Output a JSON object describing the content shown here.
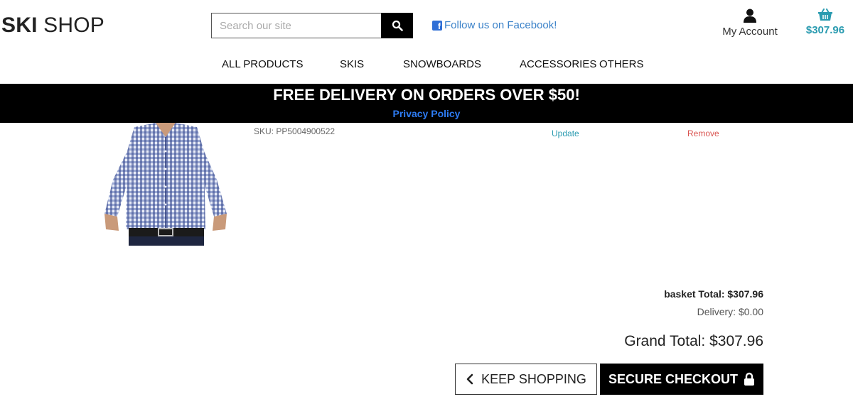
{
  "header": {
    "logo_bold": "SKI",
    "logo_thin": "SHOP",
    "search_placeholder": "Search our site",
    "facebook_label": "Follow us on Facebook!",
    "account_label": "My Account",
    "basket_total": "$307.96"
  },
  "nav": {
    "items": [
      "ALL PRODUCTS",
      "SKIS",
      "SNOWBOARDS",
      "ACCESSORIES",
      "OTHERS"
    ]
  },
  "banner": {
    "headline": "FREE DELIVERY ON ORDERS OVER $50!",
    "policy_link": "Privacy Policy"
  },
  "product": {
    "sku": "SKU: PP5004900522",
    "update_label": "Update",
    "remove_label": "Remove"
  },
  "summary": {
    "basket_total": "basket Total: $307.96",
    "delivery": "Delivery: $0.00",
    "grand_total": "Grand Total: $307.96"
  },
  "actions": {
    "keep_shopping": "KEEP SHOPPING",
    "secure_checkout": "SECURE CHECKOUT"
  },
  "colors": {
    "accent_teal": "#2a9bb0",
    "link_blue": "#2e7df5",
    "remove_red": "#d9534f",
    "banner_bg": "#000000"
  },
  "icons": {
    "search": "search-icon",
    "facebook": "facebook-icon",
    "account": "user-icon",
    "basket": "basket-icon",
    "back": "chevron-left-icon",
    "lock": "lock-icon"
  }
}
